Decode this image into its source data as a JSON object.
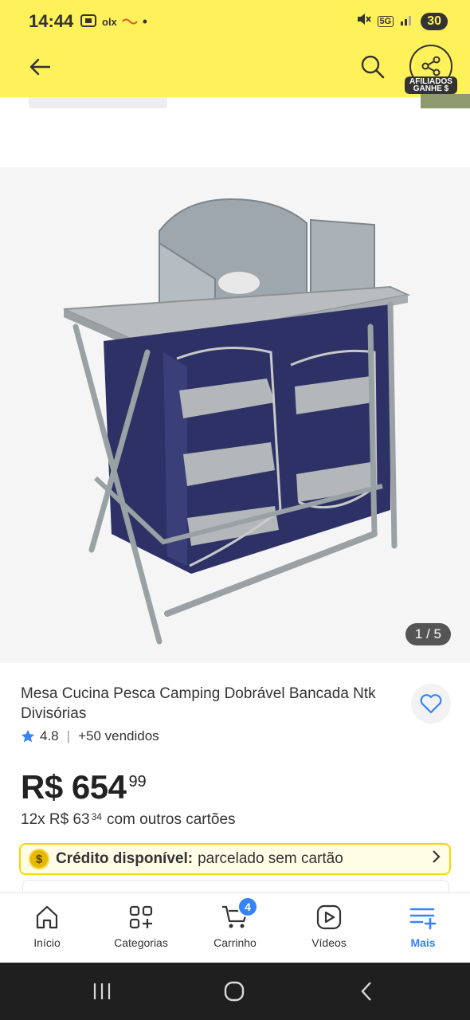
{
  "status_bar": {
    "time": "14:44",
    "left_icons": [
      "screenshot-icon",
      "olx-icon",
      "app-icon",
      "dot-icon"
    ],
    "right_icons": [
      "mute-icon",
      "5g-icon",
      "signal-icon"
    ],
    "network": "5G",
    "battery": "30"
  },
  "header": {
    "back_icon": "arrow-left-icon",
    "search_icon": "search-icon",
    "share_icon": "share-icon",
    "affiliate_label_line1": "AFILIADOS",
    "affiliate_label_line2": "GANHE $",
    "background_color": "#fff159"
  },
  "gallery": {
    "counter": "1 / 5"
  },
  "product": {
    "title": "Mesa Cucina Pesca Camping Dobrável Bancada Ntk Divisórias",
    "rating": "4.8",
    "sold": "+50 vendidos",
    "price_main": "R$ 654",
    "price_cents": "99",
    "installments_prefix": "12x R$ 63",
    "installments_cents": "34",
    "installments_suffix": "com outros cartões"
  },
  "credit_banner": {
    "icon_text": "$",
    "strong": "Crédito disponível:",
    "text": "parcelado sem cartão"
  },
  "bottom_nav": {
    "items": [
      {
        "label": "Início",
        "icon": "home-icon"
      },
      {
        "label": "Categorias",
        "icon": "grid-plus-icon"
      },
      {
        "label": "Carrinho",
        "icon": "cart-icon",
        "badge": "4"
      },
      {
        "label": "Vídeos",
        "icon": "play-icon"
      },
      {
        "label": "Mais",
        "icon": "menu-plus-icon",
        "active": true
      }
    ],
    "accent_color": "#3483fa"
  }
}
